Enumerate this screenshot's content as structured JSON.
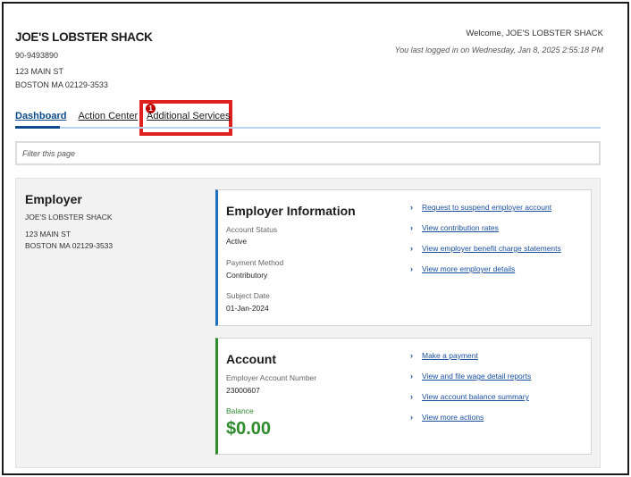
{
  "header": {
    "employer_name": "JOE'S LOBSTER SHACK",
    "employer_id": "90-9493890",
    "address_line1": "123 MAIN ST",
    "address_line2": "BOSTON MA 02129-3533",
    "welcome": "Welcome, JOE'S LOBSTER SHACK",
    "last_login": "You last logged in on Wednesday, Jan 8, 2025 2:55:18 PM"
  },
  "tabs": [
    {
      "label": "Dashboard",
      "active": true
    },
    {
      "label": "Action Center",
      "badge": "1"
    },
    {
      "label": "Additional Services",
      "highlighted": true
    }
  ],
  "filter": {
    "placeholder": "Filter this page"
  },
  "employer": {
    "title": "Employer",
    "name": "JOE'S LOBSTER SHACK",
    "address_line1": "123 MAIN ST",
    "address_line2": "BOSTON MA 02129-3533"
  },
  "employer_info": {
    "title": "Employer Information",
    "fields": [
      {
        "label": "Account Status",
        "value": "Active"
      },
      {
        "label": "Payment Method",
        "value": "Contributory"
      },
      {
        "label": "Subject Date",
        "value": "01-Jan-2024"
      }
    ],
    "links": [
      "Request to suspend employer account",
      "View contribution rates",
      "View employer benefit charge statements",
      "View more employer details"
    ]
  },
  "account": {
    "title": "Account",
    "number_label": "Employer Account Number",
    "number_value": "23000607",
    "balance_label": "Balance",
    "balance_value": "$0.00",
    "links": [
      "Make a payment",
      "View and file wage detail reports",
      "View account balance summary",
      "View more actions"
    ]
  },
  "colors": {
    "accent_blue": "#0c4a8a",
    "link_blue": "#1a4fa0",
    "balance_green": "#2e8b2e",
    "highlight_red": "#e01f1f",
    "badge_red": "#c00000"
  }
}
